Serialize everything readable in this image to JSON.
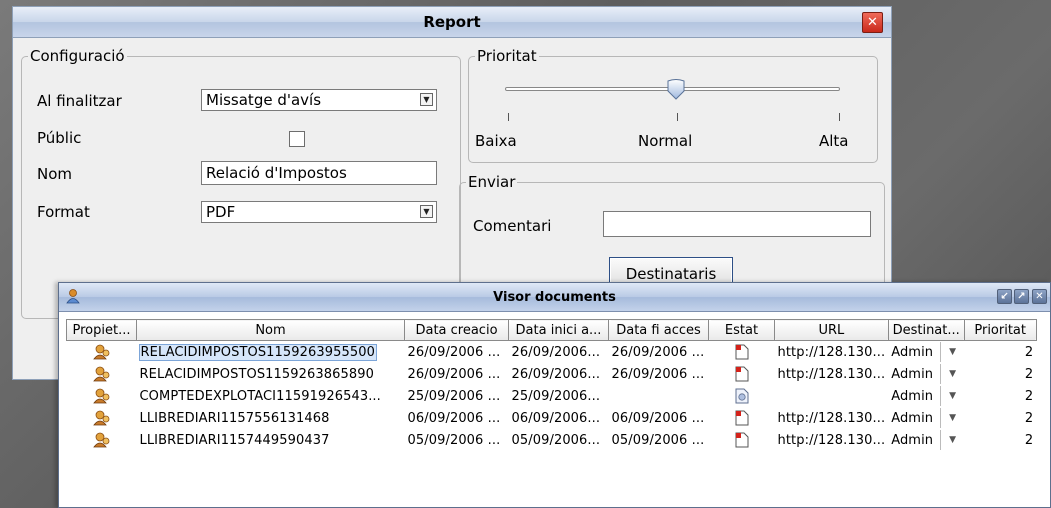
{
  "report": {
    "title": "Report",
    "configuracio": {
      "legend": "Configuració",
      "al_finalitzar_label": "Al finalitzar",
      "al_finalitzar_value": "Missatge d'avís",
      "public_label": "Públic",
      "public_checked": false,
      "nom_label": "Nom",
      "nom_value": "Relació d'Impostos",
      "format_label": "Format",
      "format_value": "PDF"
    },
    "prioritat": {
      "legend": "Prioritat",
      "low_label": "Baixa",
      "mid_label": "Normal",
      "high_label": "Alta",
      "value": "Normal"
    },
    "enviar": {
      "legend": "Enviar",
      "comentari_label": "Comentari",
      "comentari_value": "",
      "destinataris_button": "Destinataris"
    }
  },
  "visor": {
    "title": "Visor documents",
    "columns": [
      "Propiet...",
      "Nom",
      "Data creacio",
      "Data inici a...",
      "Data fi acces",
      "Estat",
      "URL",
      "Destinat...",
      "Prioritat"
    ],
    "rows": [
      {
        "nom": "RELACIDIMPOSTOS1159263955500",
        "creacio": "26/09/2006 ...",
        "inici": "26/09/2006...",
        "fi": "26/09/2006 ...",
        "estat": "pdf-icon",
        "url": "http://128.130...",
        "dest": "Admin",
        "prioritat": "2"
      },
      {
        "nom": "RELACIDIMPOSTOS1159263865890",
        "creacio": "26/09/2006 ...",
        "inici": "26/09/2006...",
        "fi": "26/09/2006 ...",
        "estat": "pdf-icon",
        "url": "http://128.130...",
        "dest": "Admin",
        "prioritat": "2"
      },
      {
        "nom": "COMPTEDEXPLOTACI11591926543...",
        "creacio": "25/09/2006 ...",
        "inici": "25/09/2006...",
        "fi": "",
        "estat": "pending-icon",
        "url": "",
        "dest": "Admin",
        "prioritat": "2"
      },
      {
        "nom": "LLIBREDIARI1157556131468",
        "creacio": "06/09/2006 ...",
        "inici": "06/09/2006...",
        "fi": "06/09/2006 ...",
        "estat": "pdf-icon",
        "url": "http://128.130...",
        "dest": "Admin",
        "prioritat": "2"
      },
      {
        "nom": "LLIBREDIARI1157449590437",
        "creacio": "05/09/2006 ...",
        "inici": "05/09/2006...",
        "fi": "05/09/2006 ...",
        "estat": "pdf-icon",
        "url": "http://128.130...",
        "dest": "Admin",
        "prioritat": "2"
      }
    ]
  }
}
